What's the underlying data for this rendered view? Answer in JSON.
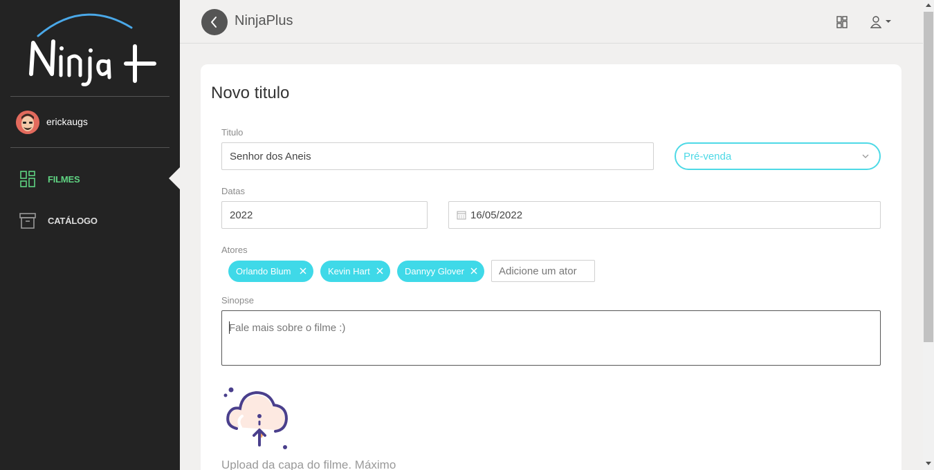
{
  "app": {
    "title": "NinjaPlus",
    "logo_text": "Ninja+"
  },
  "sidebar": {
    "username": "erickaugs",
    "items": [
      {
        "label": "FILMES",
        "icon": "dashboard-icon",
        "active": true
      },
      {
        "label": "CATÁLOGO",
        "icon": "archive-box-icon",
        "active": false
      }
    ]
  },
  "header": {
    "icons": [
      "grid-icon",
      "user-icon"
    ]
  },
  "form": {
    "page_title": "Novo titulo",
    "title_label": "Titulo",
    "title_value": "Senhor dos Aneis",
    "status_value": "Pré-venda",
    "dates_label": "Datas",
    "year_value": "2022",
    "release_date_value": "16/05/2022",
    "actors_label": "Atores",
    "actors": [
      "Orlando Blum",
      "Kevin Hart",
      "Dannyy Glover"
    ],
    "actor_placeholder": "Adicione um ator",
    "synopsis_label": "Sinopse",
    "synopsis_placeholder": "Fale mais sobre o filme :)",
    "upload_text": "Upload da capa do filme. Máximo"
  },
  "colors": {
    "accent": "#4dd9e6",
    "chip": "#3fd9e8",
    "active_nav": "#5fd382",
    "sidebar_bg": "#232323",
    "upload_purple": "#4a3f8c"
  }
}
